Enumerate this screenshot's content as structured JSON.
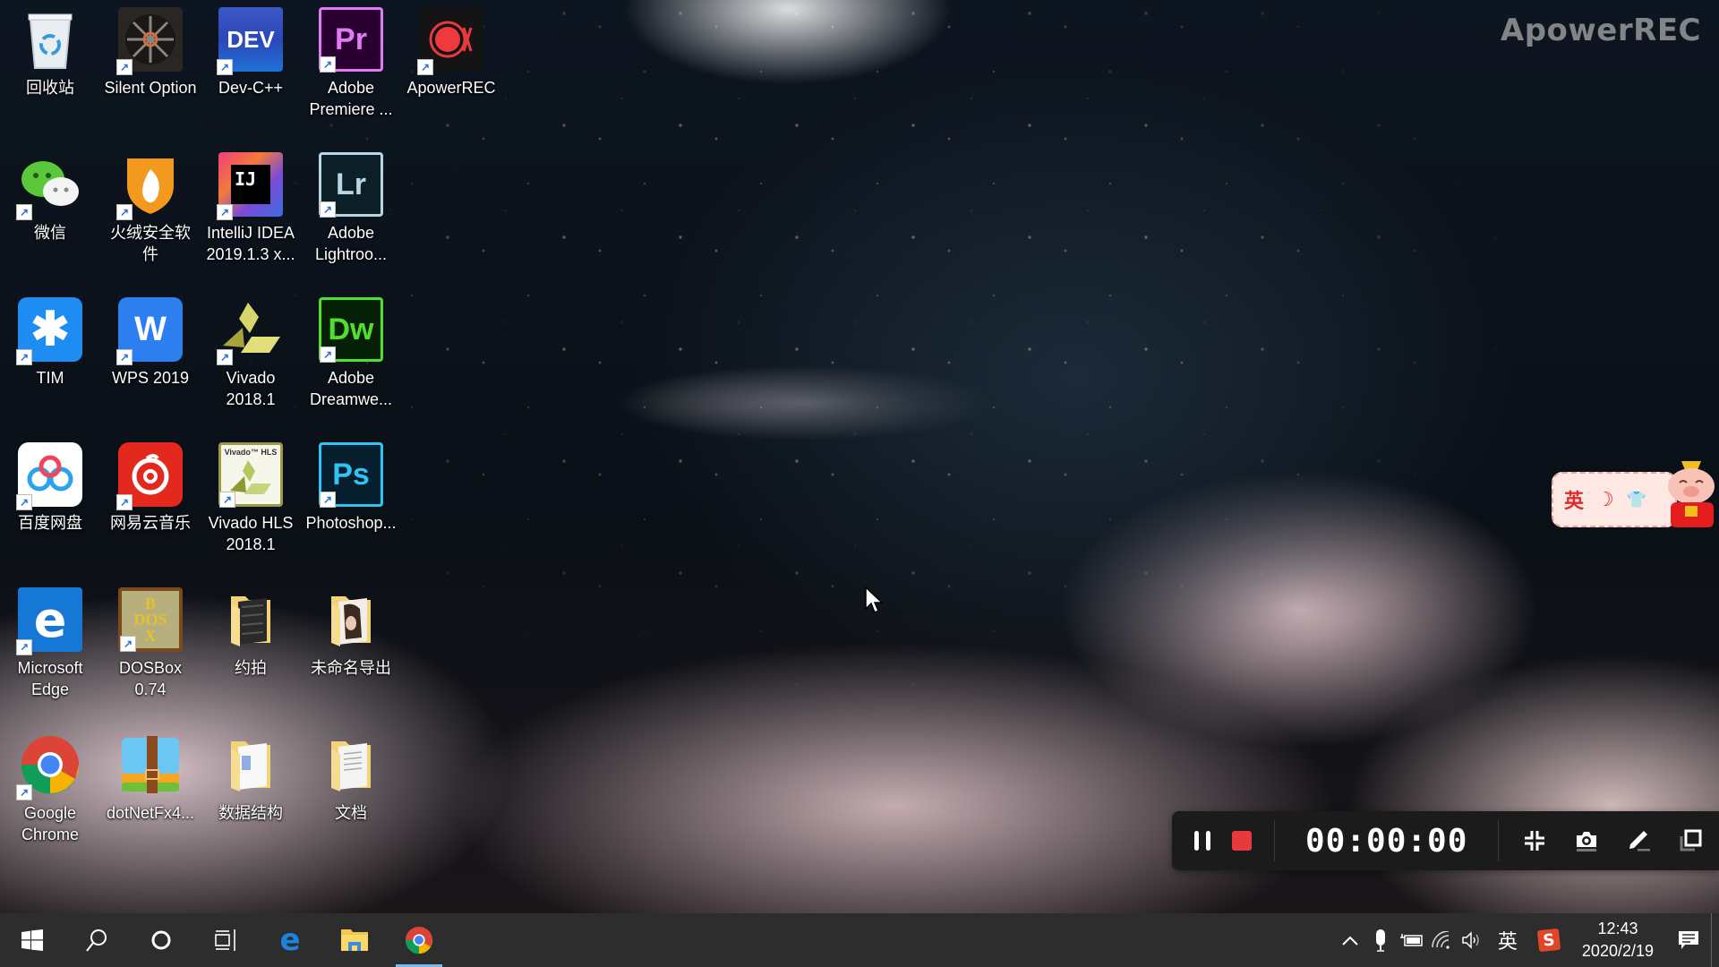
{
  "watermark": "ApowerREC",
  "desktop": {
    "icons": [
      {
        "label": "回收站",
        "icon": "recycle-bin-icon",
        "shortcut": false
      },
      {
        "label": "Silent Option",
        "icon": "silent-option-icon",
        "shortcut": true
      },
      {
        "label": "Dev-C++",
        "icon": "devcpp-icon",
        "shortcut": true
      },
      {
        "label": "Adobe Premiere ...",
        "icon": "premiere-icon",
        "shortcut": true
      },
      {
        "label": "ApowerREC",
        "icon": "apowerrec-icon",
        "shortcut": true
      },
      {
        "label": "微信",
        "icon": "wechat-icon",
        "shortcut": true
      },
      {
        "label": "火绒安全软件",
        "icon": "huorong-icon",
        "shortcut": true
      },
      {
        "label": "IntelliJ IDEA 2019.1.3 x...",
        "icon": "intellij-icon",
        "shortcut": true
      },
      {
        "label": "Adobe Lightroo...",
        "icon": "lightroom-icon",
        "shortcut": true
      },
      {
        "label": "TIM",
        "icon": "tim-icon",
        "shortcut": true
      },
      {
        "label": "WPS 2019",
        "icon": "wps-icon",
        "shortcut": true
      },
      {
        "label": "Vivado 2018.1",
        "icon": "vivado-icon",
        "shortcut": true
      },
      {
        "label": "Adobe Dreamwe...",
        "icon": "dreamweaver-icon",
        "shortcut": true
      },
      {
        "label": "百度网盘",
        "icon": "baidu-netdisk-icon",
        "shortcut": true
      },
      {
        "label": "网易云音乐",
        "icon": "netease-music-icon",
        "shortcut": true
      },
      {
        "label": "Vivado HLS 2018.1",
        "icon": "vivado-hls-icon",
        "shortcut": true
      },
      {
        "label": "Photoshop...",
        "icon": "photoshop-icon",
        "shortcut": true
      },
      {
        "label": "Microsoft Edge",
        "icon": "edge-icon",
        "shortcut": true
      },
      {
        "label": "DOSBox 0.74",
        "icon": "dosbox-icon",
        "shortcut": true
      },
      {
        "label": "约拍",
        "icon": "folder-icon",
        "shortcut": false
      },
      {
        "label": "未命名导出",
        "icon": "folder-icon",
        "shortcut": false
      },
      {
        "label": "Google Chrome",
        "icon": "chrome-icon",
        "shortcut": true
      },
      {
        "label": "dotNetFx4...",
        "icon": "archive-icon",
        "shortcut": false
      },
      {
        "label": "数据结构",
        "icon": "folder-icon",
        "shortcut": false
      },
      {
        "label": "文档",
        "icon": "folder-icon",
        "shortcut": false
      }
    ],
    "glyph_text": {
      "devcpp": "DEV",
      "premiere": "Pr",
      "lightroom": "Lr",
      "dreamweaver": "Dw",
      "photoshop": "Ps",
      "intellij": "IJ",
      "vivado_hls": "Vivado™ HLS",
      "dosbox": "DOS"
    }
  },
  "ime_float": {
    "lang": "英",
    "moon": "☽",
    "shirt": "👕"
  },
  "recorder": {
    "timer": "00:00:00",
    "pause_label": "Pause",
    "stop_label": "Stop",
    "shrink_label": "Shrink",
    "screenshot_label": "Screenshot",
    "annotate_label": "Annotate",
    "window_label": "Window",
    "stop_color": "#e8393c"
  },
  "taskbar": {
    "pinned": [
      "Start",
      "Search",
      "Cortana",
      "Task View",
      "Microsoft Edge",
      "File Explorer",
      "Google Chrome"
    ],
    "active": "Google Chrome",
    "tray": {
      "ime_lang": "英",
      "time": "12:43",
      "date": "2020/2/19"
    }
  }
}
